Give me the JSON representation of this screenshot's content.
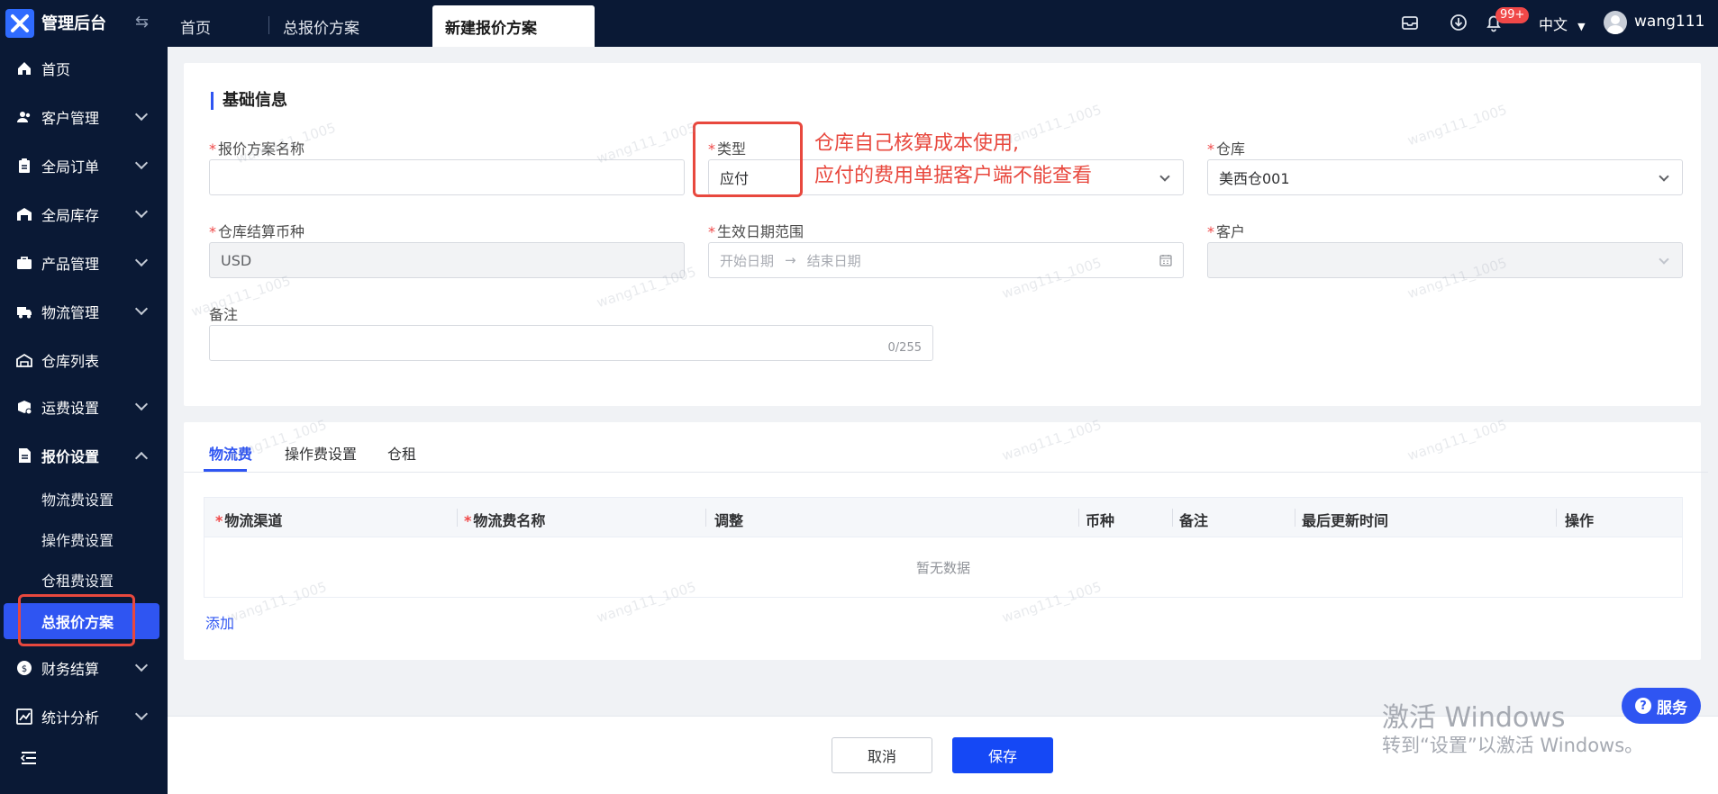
{
  "app": {
    "brand": "管理后台"
  },
  "tabs": [
    {
      "label": "首页"
    },
    {
      "label": "总报价方案"
    },
    {
      "label": "新建报价方案"
    }
  ],
  "header": {
    "notification_badge": "99+",
    "language": "中文",
    "username": "wang111"
  },
  "sidebar": {
    "items": [
      {
        "label": "首页"
      },
      {
        "label": "客户管理"
      },
      {
        "label": "全局订单"
      },
      {
        "label": "全局库存"
      },
      {
        "label": "产品管理"
      },
      {
        "label": "物流管理"
      },
      {
        "label": "仓库列表"
      },
      {
        "label": "运费设置"
      },
      {
        "label": "报价设置"
      },
      {
        "label": "财务结算"
      },
      {
        "label": "统计分析"
      }
    ],
    "subitems": [
      {
        "label": "物流费设置"
      },
      {
        "label": "操作费设置"
      },
      {
        "label": "仓租费设置"
      },
      {
        "label": "总报价方案"
      }
    ]
  },
  "form": {
    "section_title": "基础信息",
    "required_mark": "*",
    "plan_name": {
      "label": "报价方案名称",
      "value": ""
    },
    "type": {
      "label": "类型",
      "value": "应付"
    },
    "warehouse": {
      "label": "仓库",
      "value": "美西仓001"
    },
    "currency": {
      "label": "仓库结算币种",
      "value": "USD"
    },
    "date_range": {
      "label": "生效日期范围",
      "start_placeholder": "开始日期",
      "end_placeholder": "结束日期",
      "separator": "→"
    },
    "customer": {
      "label": "客户",
      "value": ""
    },
    "remark": {
      "label": "备注",
      "counter": "0/255"
    }
  },
  "annotation": {
    "line1": "仓库自己核算成本使用,",
    "line2": "应付的费用单据客户端不能查看",
    "color": "#e8483e"
  },
  "fee_tabs": [
    {
      "label": "物流费"
    },
    {
      "label": "操作费设置"
    },
    {
      "label": "仓租"
    }
  ],
  "table": {
    "columns": [
      "物流渠道",
      "物流费名称",
      "调整",
      "币种",
      "备注",
      "最后更新时间",
      "操作"
    ],
    "empty_text": "暂无数据",
    "add_label": "添加"
  },
  "footer": {
    "cancel_label": "取消",
    "save_label": "保存"
  },
  "overlay": {
    "windows_line1": "激活 Windows",
    "windows_line2": "转到“设置”以激活 Windows。",
    "service_label": "服务",
    "watermark": "wang111_1005"
  },
  "colors": {
    "accent": "#2f55f2",
    "sidebar_bg": "#0a1935",
    "danger": "#e8483e"
  }
}
